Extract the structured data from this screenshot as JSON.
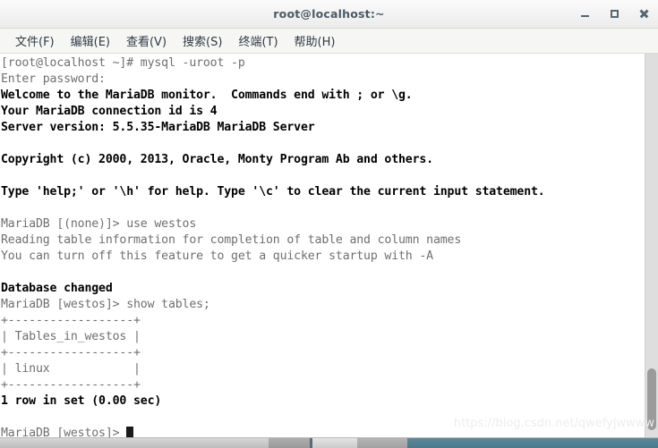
{
  "window": {
    "title": "root@localhost:~",
    "controls": {
      "minimize_label": "minimize",
      "maximize_label": "maximize",
      "close_label": "close"
    }
  },
  "menubar": {
    "items": [
      {
        "label": "文件(F)",
        "name": "menu-file"
      },
      {
        "label": "编辑(E)",
        "name": "menu-edit"
      },
      {
        "label": "查看(V)",
        "name": "menu-view"
      },
      {
        "label": "搜索(S)",
        "name": "menu-search"
      },
      {
        "label": "终端(T)",
        "name": "menu-terminal"
      },
      {
        "label": "帮助(H)",
        "name": "menu-help"
      }
    ]
  },
  "terminal": {
    "lines": [
      {
        "text": "[root@localhost ~]# mysql -uroot -p",
        "style": "dim"
      },
      {
        "text": "Enter password:",
        "style": "dim"
      },
      {
        "text": "Welcome to the MariaDB monitor.  Commands end with ; or \\g.",
        "style": "bold"
      },
      {
        "text": "Your MariaDB connection id is 4",
        "style": "bold"
      },
      {
        "text": "Server version: 5.5.35-MariaDB MariaDB Server",
        "style": "bold"
      },
      {
        "text": "",
        "style": "norm"
      },
      {
        "text": "Copyright (c) 2000, 2013, Oracle, Monty Program Ab and others.",
        "style": "bold"
      },
      {
        "text": "",
        "style": "norm"
      },
      {
        "text": "Type 'help;' or '\\h' for help. Type '\\c' to clear the current input statement.",
        "style": "bold"
      },
      {
        "text": "",
        "style": "norm"
      },
      {
        "text": "MariaDB [(none)]> use westos",
        "style": "dim"
      },
      {
        "text": "Reading table information for completion of table and column names",
        "style": "dim"
      },
      {
        "text": "You can turn off this feature to get a quicker startup with -A",
        "style": "dim"
      },
      {
        "text": "",
        "style": "norm"
      },
      {
        "text": "Database changed",
        "style": "bold"
      },
      {
        "text": "MariaDB [westos]> show tables;",
        "style": "dim"
      },
      {
        "text": "+------------------+",
        "style": "dim"
      },
      {
        "text": "| Tables_in_westos |",
        "style": "dim"
      },
      {
        "text": "+------------------+",
        "style": "dim"
      },
      {
        "text": "| linux            |",
        "style": "dim"
      },
      {
        "text": "+------------------+",
        "style": "dim"
      },
      {
        "text": "1 row in set (0.00 sec)",
        "style": "bold"
      },
      {
        "text": "",
        "style": "norm"
      },
      {
        "text": "MariaDB [westos]> ",
        "style": "dim",
        "cursor": true
      }
    ],
    "command_history": [
      "mysql -uroot -p",
      "use westos",
      "show tables;"
    ],
    "result_table": {
      "headers": [
        "Tables_in_westos"
      ],
      "rows": [
        [
          "linux"
        ]
      ],
      "row_count_text": "1 row in set (0.00 sec)"
    },
    "server": {
      "version": "5.5.35-MariaDB MariaDB Server",
      "connection_id": "4",
      "database": "westos"
    }
  },
  "watermark": {
    "text": "https://blog.csdn.net/qwefyjwwww"
  },
  "scrollbar": {
    "thumb_top_pct": 82,
    "thumb_height_pct": 16
  }
}
